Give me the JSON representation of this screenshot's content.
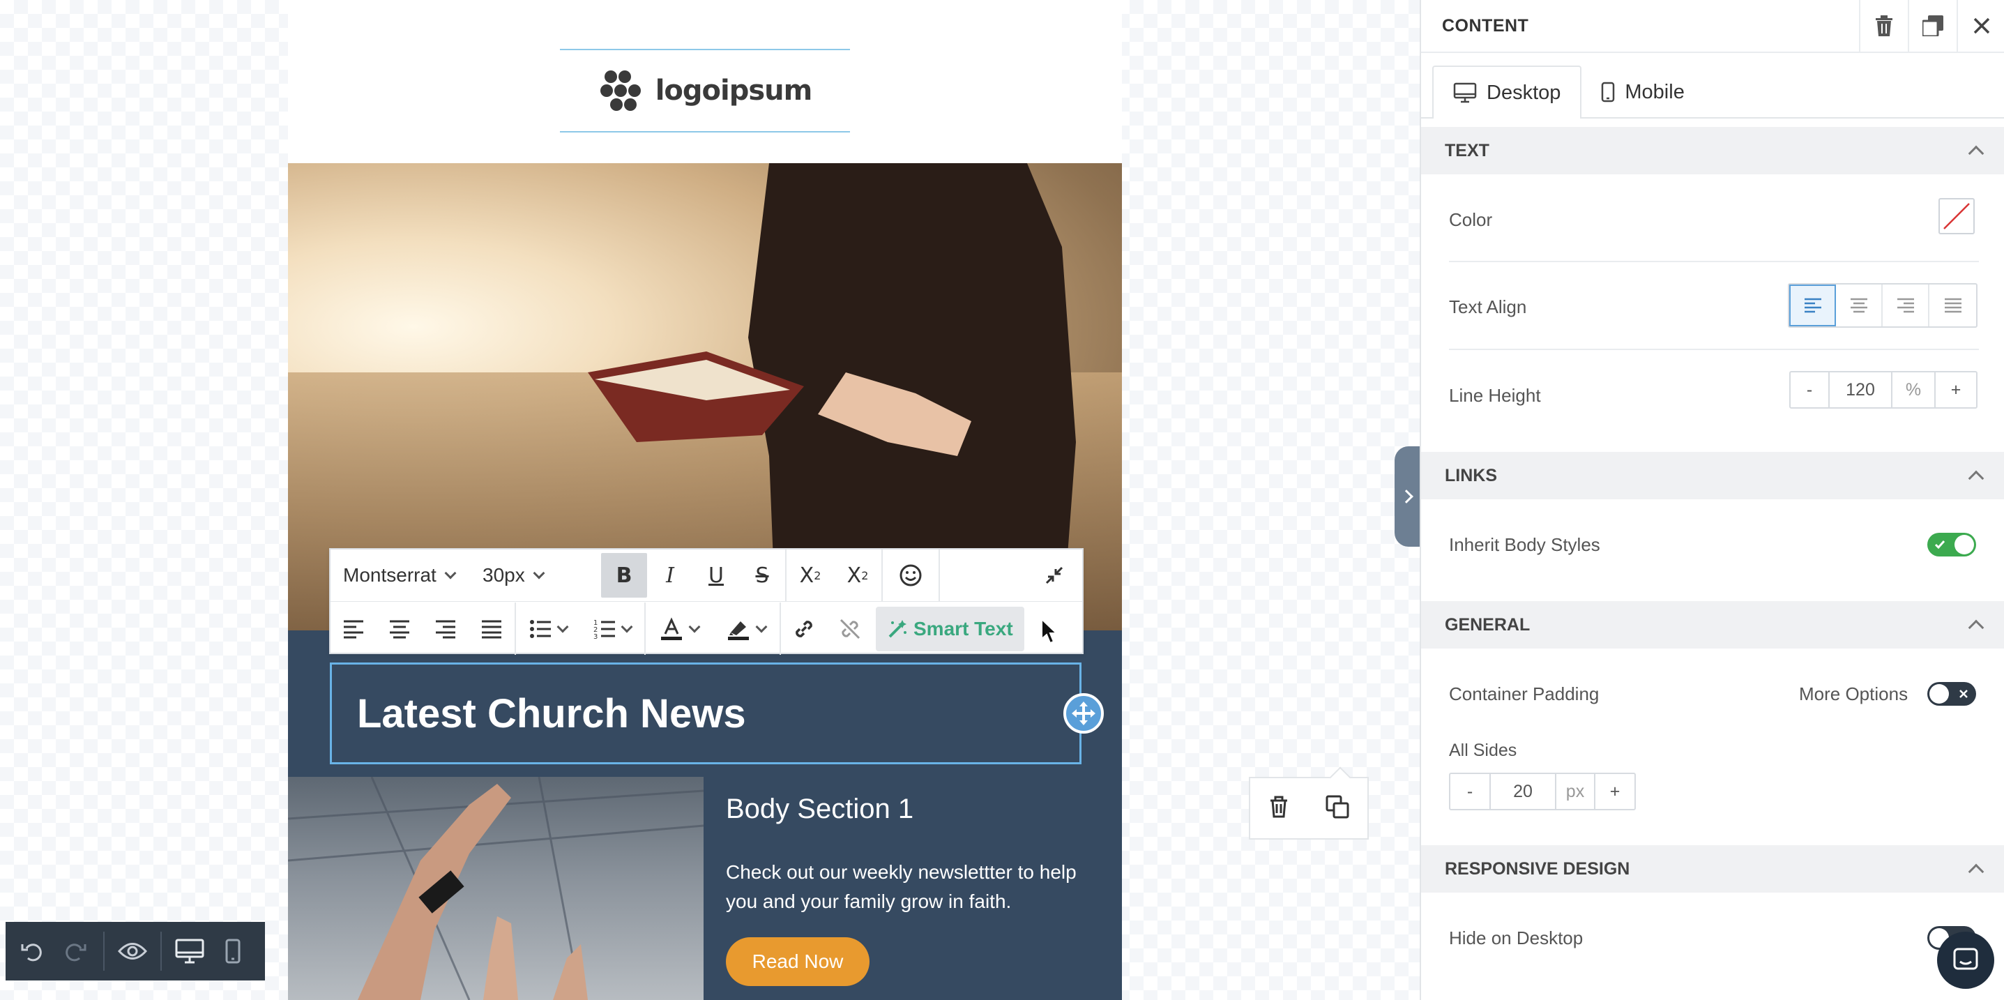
{
  "email": {
    "logo_text": "logoipsum",
    "headline": "Latest Church News",
    "body_title": "Body Section 1",
    "body_text": "Check out our weekly newslettter to help you and your family grow in faith.",
    "button_label": "Read Now"
  },
  "toolbar": {
    "font_family": "Montserrat",
    "font_size": "30px",
    "smart_text_label": "Smart Text"
  },
  "panel": {
    "title": "CONTENT",
    "tabs": [
      {
        "label": "Desktop"
      },
      {
        "label": "Mobile"
      }
    ],
    "text_section": {
      "title": "TEXT",
      "color_label": "Color",
      "align_label": "Text Align",
      "line_height_label": "Line Height",
      "line_height_value": "120",
      "line_height_unit": "%",
      "minus": "-",
      "plus": "+"
    },
    "links_section": {
      "title": "LINKS",
      "inherit_label": "Inherit Body Styles",
      "inherit_on": true
    },
    "general_section": {
      "title": "GENERAL",
      "padding_label": "Container Padding",
      "more_options_label": "More Options",
      "more_options_on": false,
      "all_sides_label": "All Sides",
      "padding_value": "20",
      "padding_unit": "px",
      "minus": "-",
      "plus": "+"
    },
    "responsive_section": {
      "title": "RESPONSIVE DESIGN",
      "hide_desktop_label": "Hide on Desktop"
    }
  },
  "colors": {
    "accent": "#5a9fd9",
    "toggle_on": "#3caa4f",
    "toggle_off": "#2f3a46",
    "button": "#e89a2f",
    "email_dark": "#364a61"
  }
}
